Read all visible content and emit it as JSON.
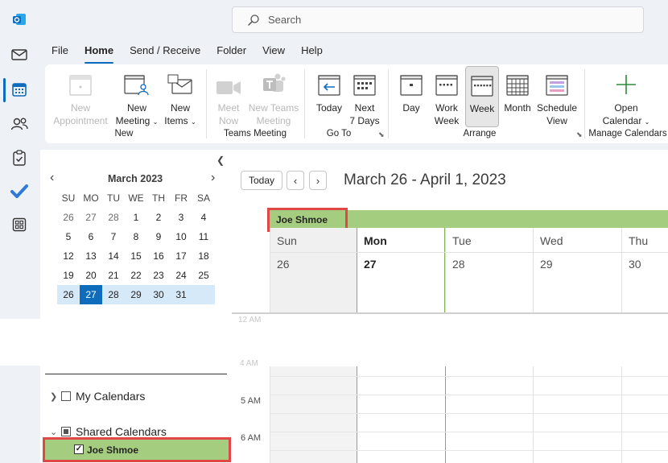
{
  "search": {
    "placeholder": "Search"
  },
  "menu": [
    "File",
    "Home",
    "Send / Receive",
    "Folder",
    "View",
    "Help"
  ],
  "ribbon": {
    "new_appointment": [
      "New",
      "Appointment"
    ],
    "new_meeting": [
      "New",
      "Meeting"
    ],
    "new_items": [
      "New",
      "Items"
    ],
    "group_new": "New",
    "meet_now": [
      "Meet",
      "Now"
    ],
    "new_teams_meeting": [
      "New Teams",
      "Meeting"
    ],
    "group_teams": "Teams Meeting",
    "today": "Today",
    "next7": [
      "Next",
      "7 Days"
    ],
    "group_goto": "Go To",
    "day": "Day",
    "work_week": [
      "Work",
      "Week"
    ],
    "week": "Week",
    "month": "Month",
    "schedule_view": [
      "Schedule",
      "View"
    ],
    "group_arrange": "Arrange",
    "open_calendar": [
      "Open",
      "Calendar"
    ],
    "group_manage": "Manage Calendars"
  },
  "mini_month": {
    "title": "March 2023",
    "dow": [
      "SU",
      "MO",
      "TU",
      "WE",
      "TH",
      "FR",
      "SA"
    ],
    "weeks": [
      [
        "26",
        "27",
        "28",
        "1",
        "2",
        "3",
        "4"
      ],
      [
        "5",
        "6",
        "7",
        "8",
        "9",
        "10",
        "11"
      ],
      [
        "12",
        "13",
        "14",
        "15",
        "16",
        "17",
        "18"
      ],
      [
        "19",
        "20",
        "21",
        "22",
        "23",
        "24",
        "25"
      ],
      [
        "26",
        "27",
        "28",
        "29",
        "30",
        "31",
        ""
      ]
    ]
  },
  "folders": {
    "my_calendars": "My Calendars",
    "shared_calendars": "Shared Calendars",
    "joe": "Joe Shmoe"
  },
  "main": {
    "today_btn": "Today",
    "range_title": "March 26 - April 1, 2023",
    "owner": "Joe Shmoe",
    "days": [
      {
        "name": "Sun",
        "num": "26"
      },
      {
        "name": "Mon",
        "num": "27"
      },
      {
        "name": "Tue",
        "num": "28"
      },
      {
        "name": "Wed",
        "num": "29"
      },
      {
        "name": "Thu",
        "num": "30"
      }
    ],
    "times": [
      "12 AM",
      "4 AM",
      "5 AM",
      "6 AM"
    ]
  },
  "colors": {
    "accent": "#0f6cbd",
    "shared_green": "#a5cd7f",
    "highlight_red": "#e04848"
  }
}
